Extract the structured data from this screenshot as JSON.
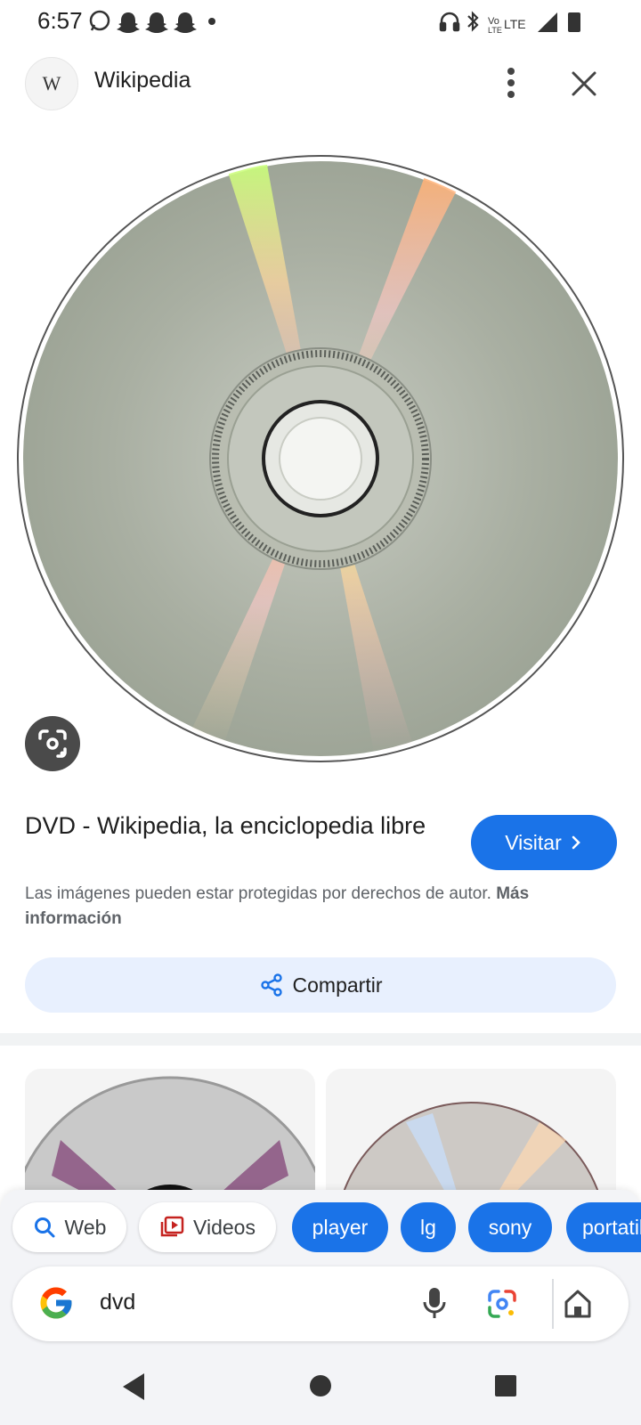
{
  "status_bar": {
    "time": "6:57",
    "network": "LTE"
  },
  "header": {
    "site_name": "Wikipedia",
    "site_badge": "W"
  },
  "result": {
    "title": "DVD - Wikipedia, la enciclopedia libre",
    "visit_label": "Visitar",
    "copyright_text": "Las imágenes pueden estar protegidas por derechos de autor.",
    "more_info_label": "Más información",
    "share_label": "Compartir"
  },
  "chips": [
    {
      "label": "Web",
      "icon": "search-icon"
    },
    {
      "label": "Videos",
      "icon": "video-icon"
    },
    {
      "label": "player"
    },
    {
      "label": "lg"
    },
    {
      "label": "sony"
    },
    {
      "label": "portatil"
    }
  ],
  "search": {
    "query": "dvd"
  },
  "colors": {
    "accent": "#1a73e8",
    "chip_bg": "#e8f0fe",
    "sheet_bg": "#f3f4f7"
  }
}
